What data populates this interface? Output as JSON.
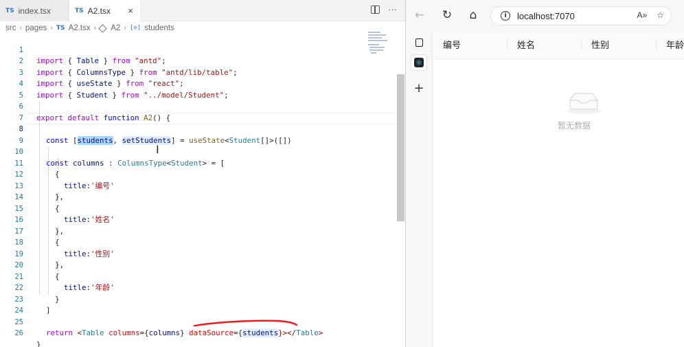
{
  "editor": {
    "tabs": [
      {
        "badge": "TS",
        "label": "index.tsx"
      },
      {
        "badge": "TS",
        "label": "A2.tsx",
        "close": "×"
      }
    ],
    "tab_actions": {
      "more": "···"
    },
    "breadcrumb": {
      "parts": [
        "src",
        "pages"
      ],
      "file_badge": "TS",
      "file": "A2.tsx",
      "component": "A2",
      "var_badge": "[⊙]",
      "variable": "students",
      "sep": "›"
    },
    "line_numbers": [
      "1",
      "2",
      "3",
      "4",
      "5",
      "6",
      "7",
      "8",
      "9",
      "10",
      "11",
      "12",
      "13",
      "14",
      "15",
      "16",
      "17",
      "18",
      "19",
      "20",
      "21",
      "22",
      "23",
      "24",
      "25",
      "26"
    ],
    "code": {
      "l1": [
        "import",
        " { ",
        "Table",
        " } ",
        "from",
        " ",
        "\"antd\"",
        ";"
      ],
      "l2": [
        "import",
        " { ",
        "ColumnsType",
        " } ",
        "from",
        " ",
        "\"antd/lib/table\"",
        ";"
      ],
      "l3": [
        "import",
        " { ",
        "useState",
        " } ",
        "from",
        " ",
        "\"react\"",
        ";"
      ],
      "l4": [
        "import",
        " { ",
        "Student",
        " } ",
        "from",
        " ",
        "\"../model/Student\"",
        ";"
      ],
      "l6": [
        "export",
        " ",
        "default",
        " ",
        "function",
        " ",
        "A2",
        "() {"
      ],
      "l8": [
        "const",
        " [",
        "students",
        ", ",
        "setStudents",
        "] = ",
        "useState",
        "<",
        "Student",
        "[]>([])"
      ],
      "l10": [
        "const",
        " ",
        "columns",
        " : ",
        "ColumnsType",
        "<",
        "Student",
        "> = ["
      ],
      "l11": "{",
      "l12": [
        "title",
        ":",
        "'编号'"
      ],
      "l13": "},",
      "l14": "{",
      "l15": [
        "title",
        ":",
        "'姓名'"
      ],
      "l16": "},",
      "l17": "{",
      "l18": [
        "title",
        ":",
        "'性别'"
      ],
      "l19": "},",
      "l20": "{",
      "l21": [
        "title",
        ":",
        "'年龄'"
      ],
      "l22": "}",
      "l23": "]",
      "l25": [
        "return",
        " <",
        "Table",
        " ",
        "columns",
        "={",
        "columns",
        "} ",
        "dataSource",
        "={",
        "students",
        "}></",
        "Table",
        ">"
      ],
      "l26": "}"
    },
    "text_cursor": "I"
  },
  "browser": {
    "url": "localhost:7070",
    "nav": {
      "back": "←",
      "reload": "↻",
      "home": "⌂"
    },
    "addr_icons": {
      "info": "i",
      "read_aloud": "A»",
      "favorite": "☆"
    },
    "side_tabs": {
      "new_tab": "+",
      "react_badge": "⚛"
    },
    "table": {
      "columns": [
        "编号",
        "姓名",
        "性别",
        "年龄"
      ],
      "empty_text": "暂无数据"
    }
  },
  "icons": [
    "file-ts-icon",
    "close-icon",
    "split-editor-icon",
    "more-icon",
    "component-icon",
    "variable-icon",
    "back-icon",
    "reload-icon",
    "home-icon",
    "info-icon",
    "read-aloud-icon",
    "favorite-icon",
    "tab-actions-icon",
    "react-devtools-icon",
    "new-tab-icon",
    "empty-inbox-icon"
  ],
  "colors": {
    "keyword": "#0000ff",
    "control": "#af00db",
    "string": "#a31515",
    "type": "#267f99",
    "function": "#795e26",
    "variable": "#001080",
    "jsx_tag": "#800000",
    "jsx_attr": "#e50000",
    "selection": "#add6ff",
    "annotation": "#ee1c1c"
  }
}
